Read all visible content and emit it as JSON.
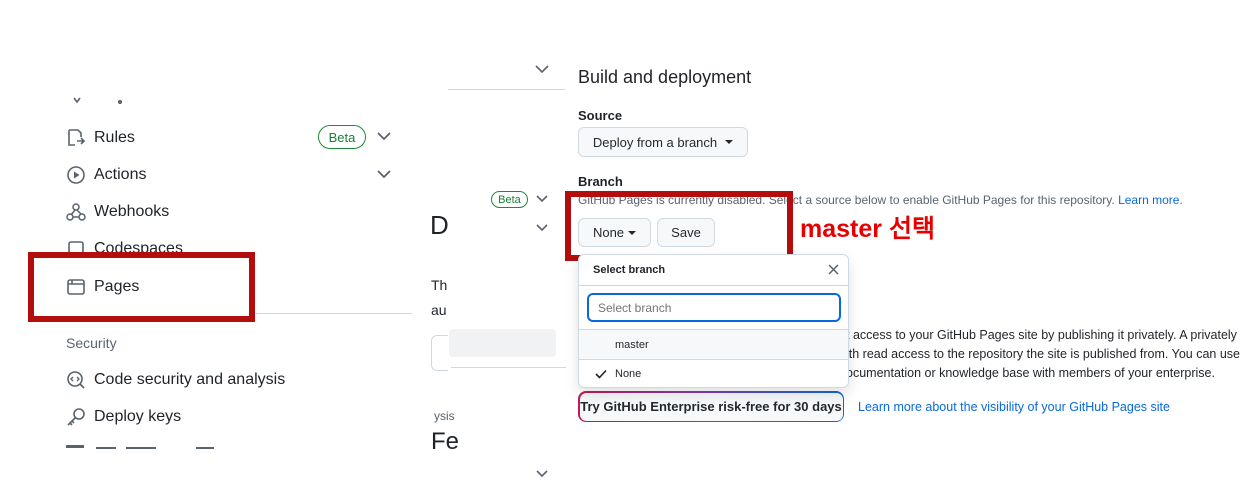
{
  "sidebar": {
    "items": [
      {
        "label": "Rules",
        "icon": "rules-icon",
        "badge": "Beta"
      },
      {
        "label": "Actions",
        "icon": "actions-icon"
      },
      {
        "label": "Webhooks",
        "icon": "webhooks-icon"
      },
      {
        "label": "Codespaces",
        "icon": "codespaces-icon"
      },
      {
        "label": "Pages",
        "icon": "pages-icon"
      }
    ],
    "security_heading": "Security",
    "security_items": [
      {
        "label": "Code security and analysis",
        "icon": "code-security-icon"
      },
      {
        "label": "Deploy keys",
        "icon": "key-icon"
      }
    ]
  },
  "middle": {
    "beta_badge": "Beta",
    "heading_fragment": "D",
    "text_fragment_1": "Th",
    "text_fragment_2": "au",
    "small_fragment": "ysis",
    "heading_fragment_2": "Fe"
  },
  "main": {
    "section_title": "Build and deployment",
    "source_label": "Source",
    "source_value": "Deploy from a branch",
    "branch_label": "Branch",
    "branch_description": "GitHub Pages is currently disabled. Select a source below to enable GitHub Pages for this repository.",
    "learn_more": "Learn more.",
    "branch_button": "None",
    "save_button": "Save",
    "annotation": "master 선택",
    "visibility_text_1": "t access to your GitHub Pages site by publishing it privately. A privately",
    "visibility_text_2": "ith read access to the repository the site is published from. You can use",
    "visibility_text_3": "ocumentation or knowledge base with members of your enterprise.",
    "enterprise_button": "Try GitHub Enterprise risk-free for 30 days",
    "visibility_link": "Learn more about the visibility of your GitHub Pages site"
  },
  "dropdown": {
    "title": "Select branch",
    "filter_placeholder": "Select branch",
    "options": [
      {
        "label": "master",
        "selected": false
      },
      {
        "label": "None",
        "selected": true
      }
    ]
  },
  "colors": {
    "annotation_red": "#e60000",
    "highlight_box": "#b40d0d",
    "link_blue": "#0969da",
    "beta_green": "#1a7f37",
    "focus_blue": "#0969da"
  }
}
